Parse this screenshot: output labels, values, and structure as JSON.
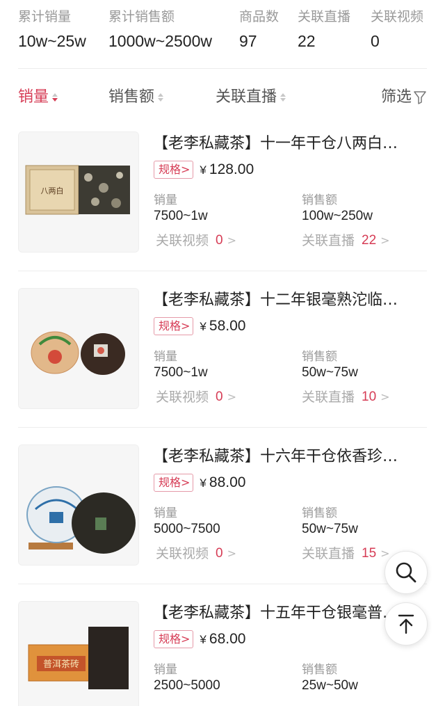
{
  "stats": [
    {
      "label": "累计销量",
      "value": "10w~25w"
    },
    {
      "label": "累计销售额",
      "value": "1000w~2500w"
    },
    {
      "label": "商品数",
      "value": "97"
    },
    {
      "label": "关联直播",
      "value": "22"
    },
    {
      "label": "关联视频",
      "value": "0"
    }
  ],
  "sort": {
    "sales": "销量",
    "revenue": "销售额",
    "live": "关联直播",
    "filter": "筛选"
  },
  "colors": {
    "accent": "#d63c55",
    "muted": "#999999"
  },
  "labels": {
    "spec": "规格>",
    "sales": "销量",
    "revenue": "销售额",
    "video": "关联视频",
    "live": "关联直播",
    "yen": "¥"
  },
  "products": [
    {
      "title": "【老李私藏茶】十一年干仓八两白…",
      "price": "128.00",
      "sales": "7500~1w",
      "revenue": "100w~250w",
      "videos": "0",
      "lives": "22"
    },
    {
      "title": "【老李私藏茶】十二年银毫熟沱临…",
      "price": "58.00",
      "sales": "7500~1w",
      "revenue": "50w~75w",
      "videos": "0",
      "lives": "10"
    },
    {
      "title": "【老李私藏茶】十六年干仓依香珍…",
      "price": "88.00",
      "sales": "5000~7500",
      "revenue": "50w~75w",
      "videos": "0",
      "lives": "15"
    },
    {
      "title": "【老李私藏茶】十五年干仓银毫普…",
      "price": "68.00",
      "sales": "2500~5000",
      "revenue": "25w~50w",
      "videos": "",
      "lives": ""
    }
  ],
  "icons": {
    "search": "search-icon",
    "top": "back-to-top-icon",
    "filter": "filter-icon"
  }
}
